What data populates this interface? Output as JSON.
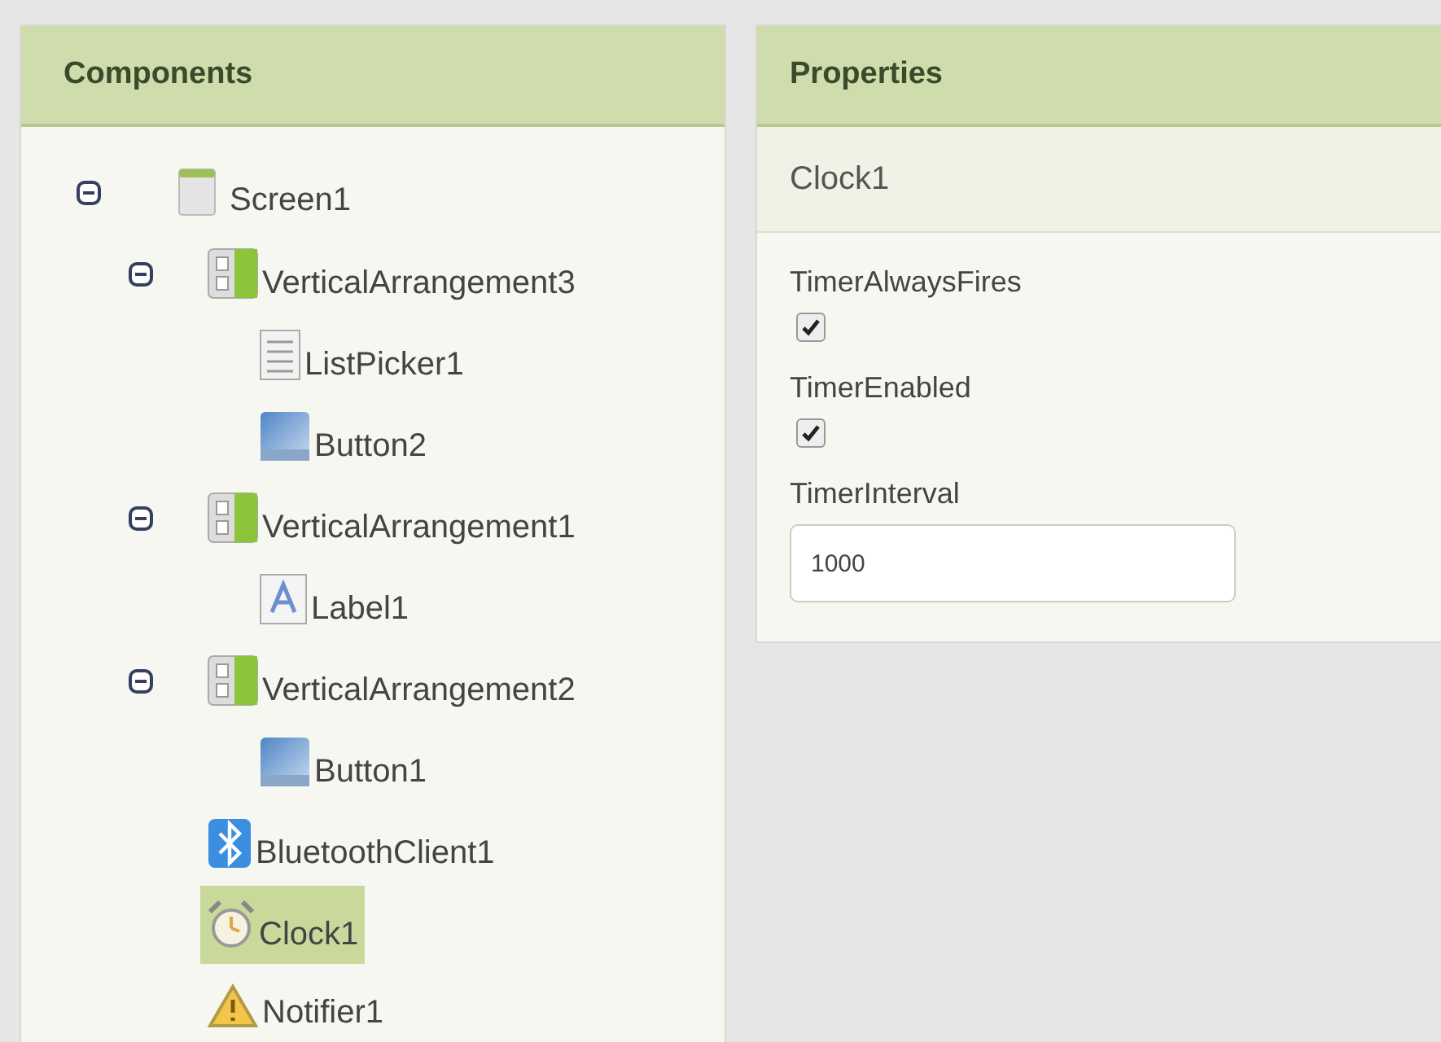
{
  "components": {
    "title": "Components",
    "tree": [
      {
        "label": "Screen1",
        "kind": "screen",
        "selected": false,
        "expanded": true,
        "children": [
          {
            "label": "VerticalArrangement3",
            "kind": "arrangement",
            "selected": false,
            "expanded": true,
            "children": [
              {
                "label": "ListPicker1",
                "kind": "listpicker",
                "selected": false
              },
              {
                "label": "Button2",
                "kind": "button",
                "selected": false
              }
            ]
          },
          {
            "label": "VerticalArrangement1",
            "kind": "arrangement",
            "selected": false,
            "expanded": true,
            "children": [
              {
                "label": "Label1",
                "kind": "label",
                "selected": false
              }
            ]
          },
          {
            "label": "VerticalArrangement2",
            "kind": "arrangement",
            "selected": false,
            "expanded": true,
            "children": [
              {
                "label": "Button1",
                "kind": "button",
                "selected": false
              }
            ]
          },
          {
            "label": "BluetoothClient1",
            "kind": "bluetooth",
            "selected": false
          },
          {
            "label": "Clock1",
            "kind": "clock",
            "selected": true
          },
          {
            "label": "Notifier1",
            "kind": "notifier",
            "selected": false
          }
        ]
      }
    ]
  },
  "properties": {
    "title": "Properties",
    "component": "Clock1",
    "items": [
      {
        "kind": "checkbox",
        "label": "TimerAlwaysFires",
        "checked": true
      },
      {
        "kind": "checkbox",
        "label": "TimerEnabled",
        "checked": true
      },
      {
        "kind": "text",
        "label": "TimerInterval",
        "value": "1000"
      }
    ]
  }
}
